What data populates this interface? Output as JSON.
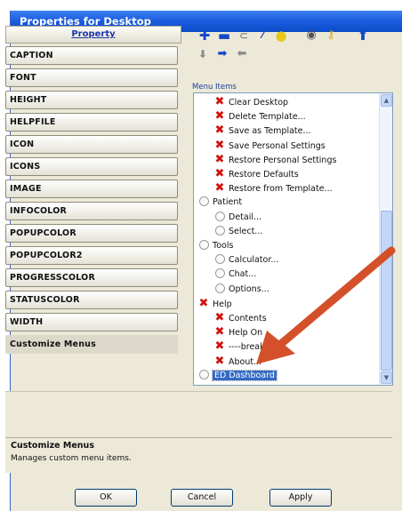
{
  "window": {
    "title": "Properties for Desktop"
  },
  "property_panel": {
    "header": "Property",
    "items": [
      "CAPTION",
      "FONT",
      "HEIGHT",
      "HELPFILE",
      "ICON",
      "ICONS",
      "IMAGE",
      "INFOCOLOR",
      "POPUPCOLOR",
      "POPUPCOLOR2",
      "PROGRESSCOLOR",
      "STATUSCOLOR",
      "WIDTH",
      "Customize Menus"
    ],
    "selected": "Customize Menus"
  },
  "toolbar": {
    "icons": [
      "add-icon",
      "remove-icon",
      "link-icon",
      "wand-icon",
      "lightbulb-icon",
      "lock-icon",
      "key-icon",
      "move-up-icon",
      "move-down-icon",
      "indent-icon",
      "outdent-icon"
    ]
  },
  "menu_items": {
    "label": "Menu Items",
    "tree": [
      {
        "label": "Clear Desktop",
        "icon": "x-icon",
        "level": 1
      },
      {
        "label": "Delete Template...",
        "icon": "x-icon",
        "level": 1
      },
      {
        "label": "Save as Template...",
        "icon": "x-icon",
        "level": 1
      },
      {
        "label": "Save Personal Settings",
        "icon": "x-icon",
        "level": 1
      },
      {
        "label": "Restore Personal Settings",
        "icon": "x-icon",
        "level": 1
      },
      {
        "label": "Restore Defaults",
        "icon": "x-icon",
        "level": 1
      },
      {
        "label": "Restore from Template...",
        "icon": "x-icon",
        "level": 1
      },
      {
        "label": "Patient",
        "icon": "folder-icon",
        "level": 0
      },
      {
        "label": "Detail...",
        "icon": "folder-icon",
        "level": 1
      },
      {
        "label": "Select...",
        "icon": "folder-icon",
        "level": 1
      },
      {
        "label": "Tools",
        "icon": "folder-icon",
        "level": 0
      },
      {
        "label": "Calculator...",
        "icon": "folder-icon",
        "level": 1
      },
      {
        "label": "Chat...",
        "icon": "folder-icon",
        "level": 1
      },
      {
        "label": "Options...",
        "icon": "folder-icon",
        "level": 1
      },
      {
        "label": "Help",
        "icon": "x-icon",
        "level": 0
      },
      {
        "label": "Contents",
        "icon": "x-icon",
        "level": 1
      },
      {
        "label": "Help On",
        "icon": "x-icon",
        "level": 1
      },
      {
        "label": "----break",
        "icon": "x-icon",
        "level": 1
      },
      {
        "label": "About...",
        "icon": "x-icon",
        "level": 1
      },
      {
        "label": "ED Dashboard",
        "icon": "folder-icon",
        "level": 0
      }
    ],
    "selected": "ED Dashboard"
  },
  "description": {
    "title": "Customize Menus",
    "text": "Manages custom menu items."
  },
  "buttons": {
    "ok": "OK",
    "cancel": "Cancel",
    "apply": "Apply"
  },
  "colors": {
    "accent": "#316ac5",
    "arrow": "#d4502a",
    "title_bar": "#0a4bc8"
  }
}
